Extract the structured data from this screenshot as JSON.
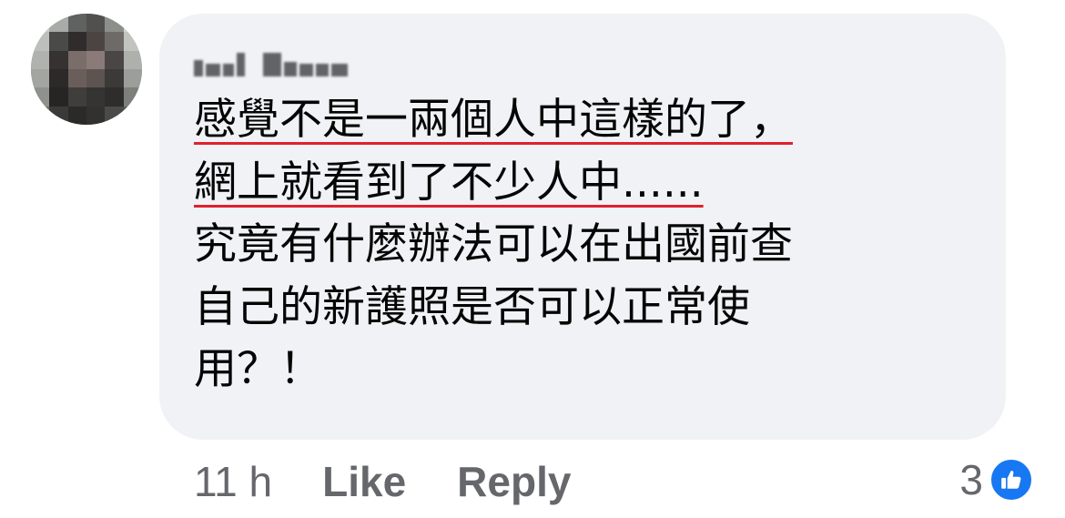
{
  "comment": {
    "author_name_obscured": true,
    "lines": [
      "感覺不是一兩個人中這樣的了，",
      "網上就看到了不少人中......",
      "究竟有什麼辦法可以在出國前查",
      "自己的新護照是否可以正常使",
      "用？！"
    ],
    "underlined_lines": [
      0,
      1
    ],
    "underline_color": "#e0202e"
  },
  "actions": {
    "time": "11 h",
    "like_label": "Like",
    "reply_label": "Reply"
  },
  "reactions": {
    "count": "3",
    "icon": "thumbs-up-icon",
    "badge_color": "#1877f2"
  },
  "colors": {
    "bubble": "#f0f2f5",
    "text": "#050505",
    "secondary_text": "#65676b"
  }
}
